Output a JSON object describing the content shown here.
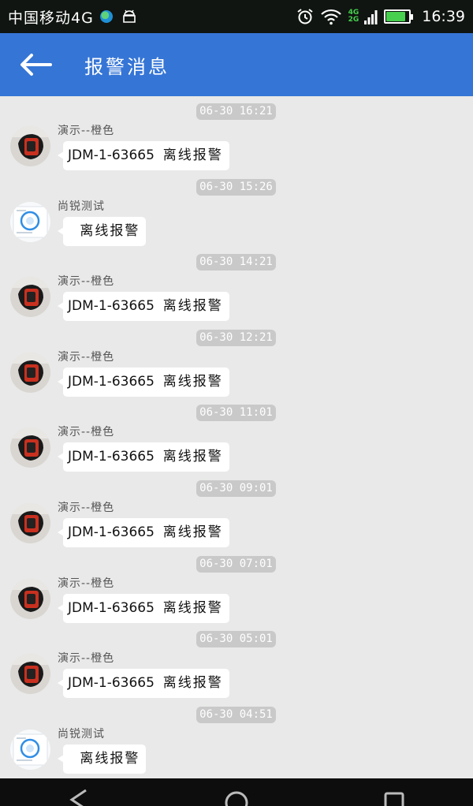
{
  "status_bar": {
    "carrier": "中国移动4G",
    "time": "16:39",
    "net_top": "4G",
    "net_bottom": "2G",
    "icons": [
      "globe-icon",
      "android-icon",
      "alarm-icon",
      "wifi-icon",
      "signal-icon",
      "battery-charging-icon"
    ],
    "battery_level": 0.85
  },
  "app_bar": {
    "title": "报警消息",
    "back_icon": "arrow-left-icon",
    "color": "#3575d6"
  },
  "messages": [
    {
      "timestamp": "06-30 16:21",
      "sender": "演示--橙色",
      "device": "JDM-1-63665",
      "alert": "离线报警",
      "avatar": "watch-photo"
    },
    {
      "timestamp": "06-30 15:26",
      "sender": "尚锐测试",
      "device": "",
      "alert": "离线报警",
      "avatar": "app-screenshot"
    },
    {
      "timestamp": "06-30 14:21",
      "sender": "演示--橙色",
      "device": "JDM-1-63665",
      "alert": "离线报警",
      "avatar": "watch-photo"
    },
    {
      "timestamp": "06-30 12:21",
      "sender": "演示--橙色",
      "device": "JDM-1-63665",
      "alert": "离线报警",
      "avatar": "watch-photo"
    },
    {
      "timestamp": "06-30 11:01",
      "sender": "演示--橙色",
      "device": "JDM-1-63665",
      "alert": "离线报警",
      "avatar": "watch-photo"
    },
    {
      "timestamp": "06-30 09:01",
      "sender": "演示--橙色",
      "device": "JDM-1-63665",
      "alert": "离线报警",
      "avatar": "watch-photo"
    },
    {
      "timestamp": "06-30 07:01",
      "sender": "演示--橙色",
      "device": "JDM-1-63665",
      "alert": "离线报警",
      "avatar": "watch-photo"
    },
    {
      "timestamp": "06-30 05:01",
      "sender": "演示--橙色",
      "device": "JDM-1-63665",
      "alert": "离线报警",
      "avatar": "watch-photo"
    },
    {
      "timestamp": "06-30 04:51",
      "sender": "尚锐测试",
      "device": "",
      "alert": "离线报警",
      "avatar": "app-screenshot"
    }
  ],
  "nav_bar": {
    "buttons": [
      "back-triangle-icon",
      "home-circle-icon",
      "recents-square-icon"
    ]
  }
}
